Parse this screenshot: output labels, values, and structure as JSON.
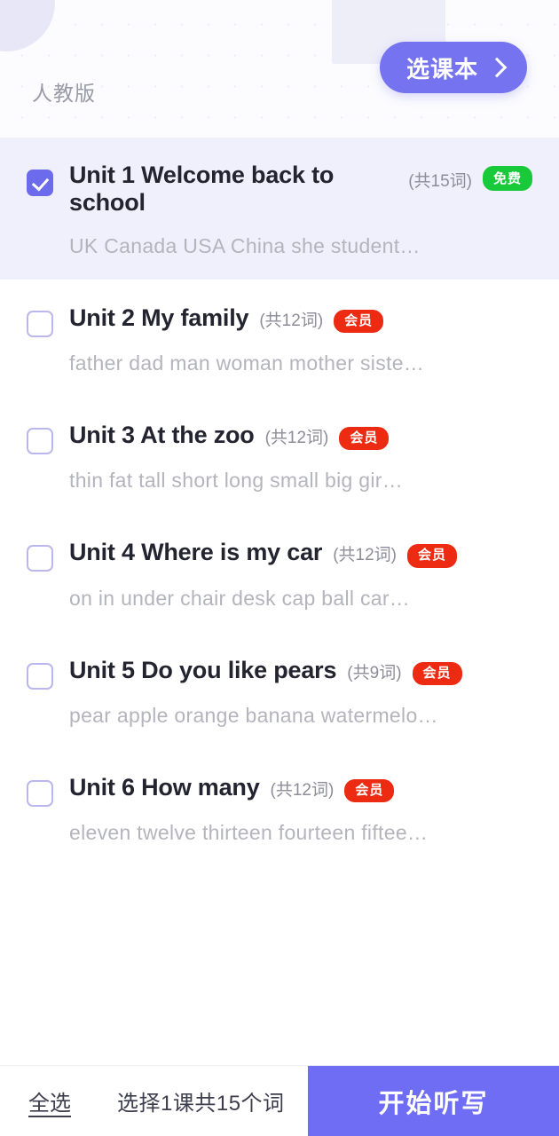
{
  "header": {
    "edition_label": "人教版",
    "pick_book_button": "选课本",
    "chevron_icon": "chevron-right-icon",
    "book_icon": "book-with-bookmark-icon",
    "accent_color": "#7573ef"
  },
  "units": [
    {
      "title": "Unit 1 Welcome back to school",
      "count": "(共15词)",
      "badge": "免费",
      "badge_type": "free",
      "badge_color": "#18c93a",
      "words": "UK  Canada  USA  China  she  student…",
      "checked": true
    },
    {
      "title": "Unit 2 My family",
      "count": "(共12词)",
      "badge": "会员",
      "badge_type": "vip",
      "badge_color": "#ec2b12",
      "words": "father  dad  man  woman  mother  siste…",
      "checked": false
    },
    {
      "title": "Unit 3 At the zoo",
      "count": "(共12词)",
      "badge": "会员",
      "badge_type": "vip",
      "badge_color": "#ec2b12",
      "words": "thin  fat  tall  short  long  small  big  gir…",
      "checked": false
    },
    {
      "title": "Unit 4 Where is my car",
      "count": "(共12词)",
      "badge": "会员",
      "badge_type": "vip",
      "badge_color": "#ec2b12",
      "words": "on  in  under  chair  desk  cap  ball  car…",
      "checked": false
    },
    {
      "title": "Unit 5 Do you like pears",
      "count": "(共9词)",
      "badge": "会员",
      "badge_type": "vip",
      "badge_color": "#ec2b12",
      "words": "pear  apple  orange  banana  watermelo…",
      "checked": false
    },
    {
      "title": "Unit 6 How many",
      "count": "(共12词)",
      "badge": "会员",
      "badge_type": "vip",
      "badge_color": "#ec2b12",
      "words": "eleven  twelve  thirteen  fourteen  fiftee…",
      "checked": false
    }
  ],
  "bottom_bar": {
    "select_all": "全选",
    "summary": "选择1课共15个词",
    "start_button": "开始听写",
    "start_button_color": "#6f6df4"
  }
}
